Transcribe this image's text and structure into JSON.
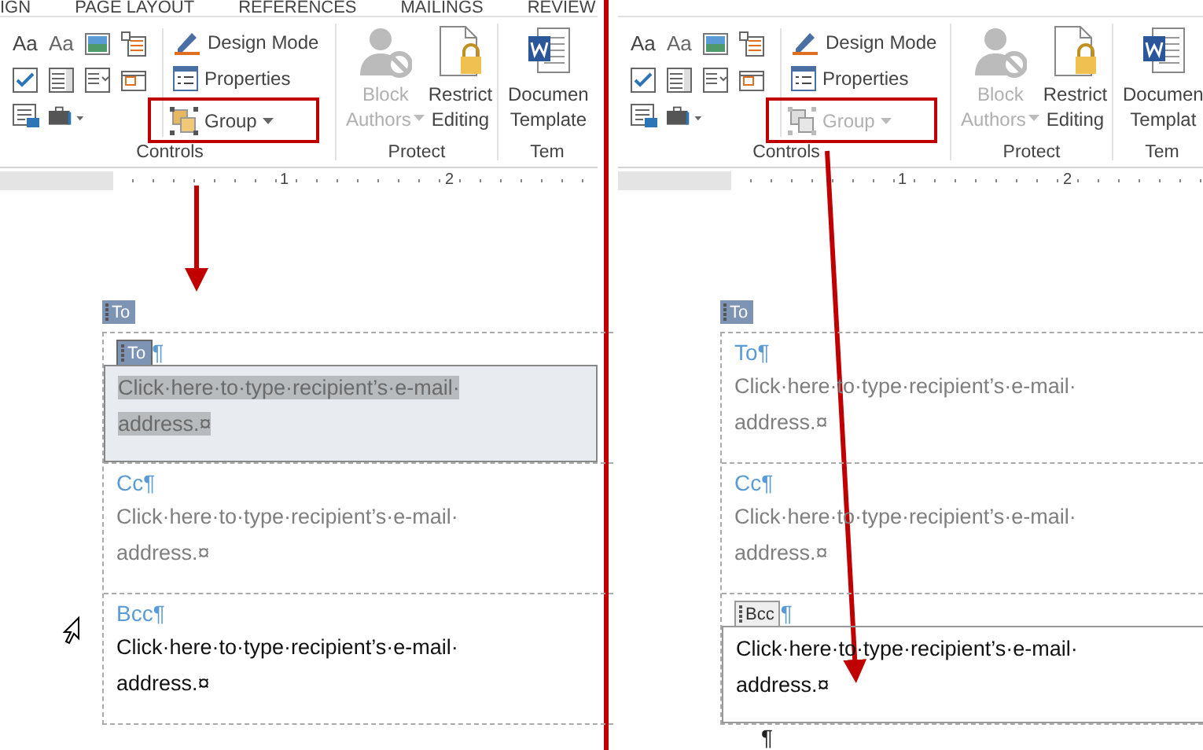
{
  "panels": [
    {
      "tabs": [
        "IGN",
        "PAGE LAYOUT",
        "REFERENCES",
        "MAILINGS",
        "REVIEW"
      ],
      "ribbon": {
        "control_icons": [
          {
            "kind": "glyph",
            "text": "Aa"
          },
          {
            "kind": "glyph",
            "text": "Aa"
          },
          {
            "kind": "picture"
          },
          {
            "kind": "gallery"
          },
          {
            "kind": "checkbox"
          },
          {
            "kind": "combo"
          },
          {
            "kind": "dropdown"
          },
          {
            "kind": "date"
          },
          {
            "kind": "repeating"
          },
          {
            "kind": "legacy"
          }
        ],
        "design_mode": "Design Mode",
        "properties": "Properties",
        "group": {
          "label": "Group",
          "disabled": false,
          "highlighted": true
        },
        "controls_label": "Controls",
        "block_authors": [
          "Block",
          "Authors"
        ],
        "restrict_editing": [
          "Restrict",
          "Editing"
        ],
        "protect_label": "Protect",
        "template": [
          "Documen",
          "Template"
        ],
        "template_label": "Tem"
      },
      "ruler": [
        "1",
        "2"
      ],
      "document": {
        "outer_tag": "To",
        "pointer": true,
        "rows": [
          {
            "label": "To",
            "mark": "¶",
            "text": "Click·here·to·type·recipient’s·e-mail·address.",
            "end": "¤",
            "selected": true,
            "dimmed": true
          },
          {
            "label": "Cc",
            "mark": "¶",
            "text": "Click·here·to·type·recipient’s·e-mail·address.",
            "end": "¤",
            "selected": false,
            "dimmed": true
          },
          {
            "label": "Bcc",
            "mark": "¶",
            "text": "Click·here·to·type·recipient’s·e-mail·address.",
            "end": "¤",
            "selected": false,
            "dimmed": false
          }
        ]
      }
    },
    {
      "ribbon": {
        "control_icons": [
          {
            "kind": "glyph",
            "text": "Aa"
          },
          {
            "kind": "glyph",
            "text": "Aa"
          },
          {
            "kind": "picture"
          },
          {
            "kind": "gallery"
          },
          {
            "kind": "checkbox"
          },
          {
            "kind": "combo"
          },
          {
            "kind": "dropdown"
          },
          {
            "kind": "date"
          },
          {
            "kind": "repeating"
          },
          {
            "kind": "legacy"
          }
        ],
        "design_mode": "Design Mode",
        "properties": "Properties",
        "group": {
          "label": "Group",
          "disabled": true,
          "highlighted": true
        },
        "controls_label": "Controls",
        "block_authors": [
          "Block",
          "Authors"
        ],
        "restrict_editing": [
          "Restrict",
          "Editing"
        ],
        "protect_label": "Protect",
        "template": [
          "Documen",
          "Templat"
        ],
        "template_label": "Tem"
      },
      "ruler": [
        "1",
        "2"
      ],
      "document": {
        "outer_tag": "To",
        "pointer": false,
        "trailing_mark": "¶",
        "rows": [
          {
            "label": "To",
            "mark": "¶",
            "text": "Click·here·to·type·recipient’s·e-mail·address.",
            "end": "¤",
            "selected": false,
            "dimmed": true
          },
          {
            "label": "Cc",
            "mark": "¶",
            "text": "Click·here·to·type·recipient’s·e-mail·address.",
            "end": "¤",
            "selected": false,
            "dimmed": true
          },
          {
            "label": "Bcc",
            "mark": "¶",
            "text": "Click·here·to·type·recipient’s·e-mail·address.",
            "end": "¤",
            "selected": true,
            "dimmed": false
          }
        ]
      }
    }
  ]
}
